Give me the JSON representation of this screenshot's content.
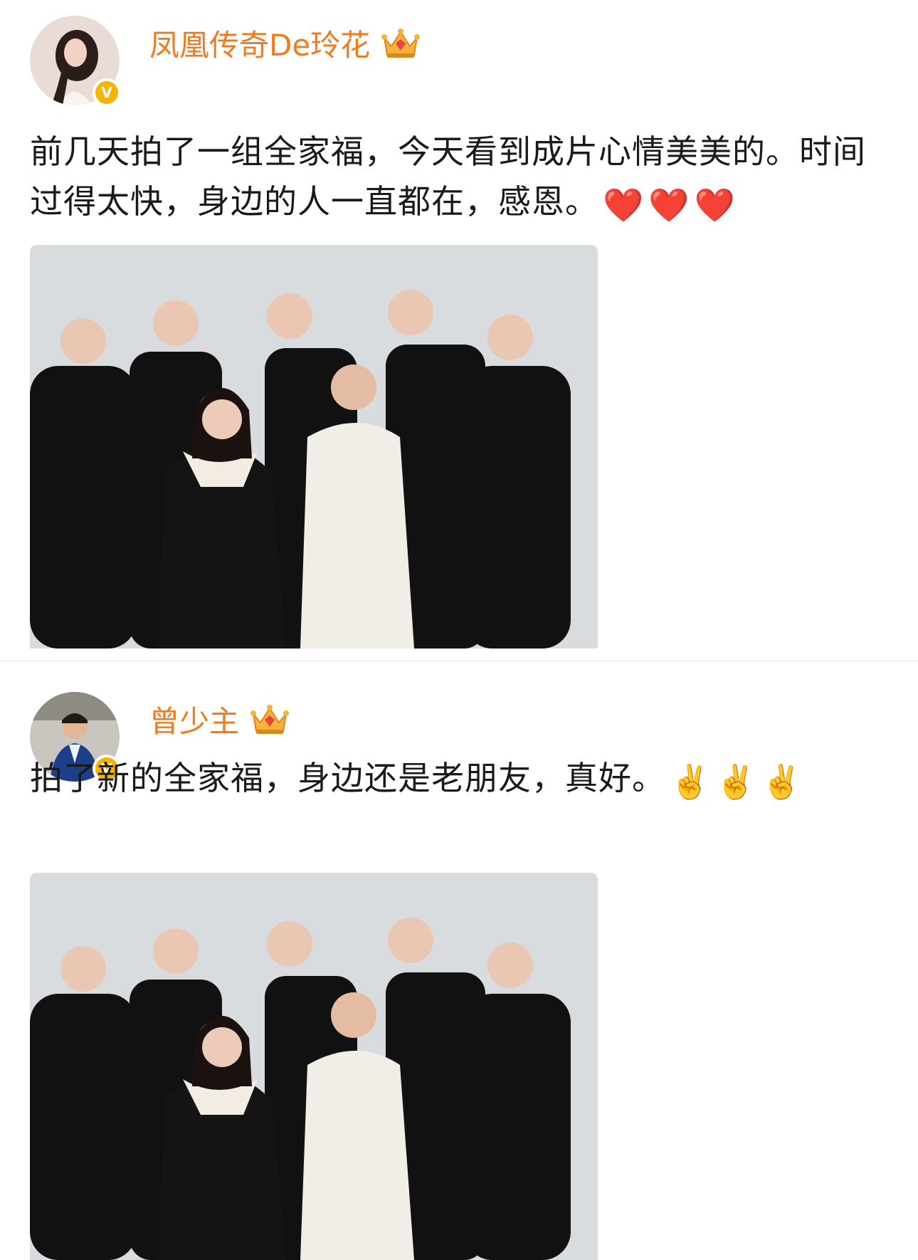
{
  "posts": [
    {
      "username": "凤凰传奇De玲花",
      "verified_badge": "V",
      "avatar_icon": "woman-portrait-avatar",
      "membership_icon": "crown-icon",
      "text": "前几天拍了一组全家福，今天看到成片心情美美的。时间过得太快，身边的人一直都在，感恩。",
      "emojis": [
        "❤️",
        "❤️",
        "❤️"
      ],
      "photo_icon": "group-photo"
    },
    {
      "username": "曾少主",
      "verified_badge": "V",
      "avatar_icon": "man-portrait-avatar",
      "membership_icon": "crown-icon",
      "text": "拍了新的全家福，身边还是老朋友，真好。",
      "emojis": [
        "✌️",
        "✌️",
        "✌️"
      ],
      "photo_icon": "group-photo"
    }
  ],
  "colors": {
    "username": "#f07a1c",
    "verified": "#f5b400",
    "text": "#1a1a1a",
    "photo_bg": "#d6dadd"
  }
}
